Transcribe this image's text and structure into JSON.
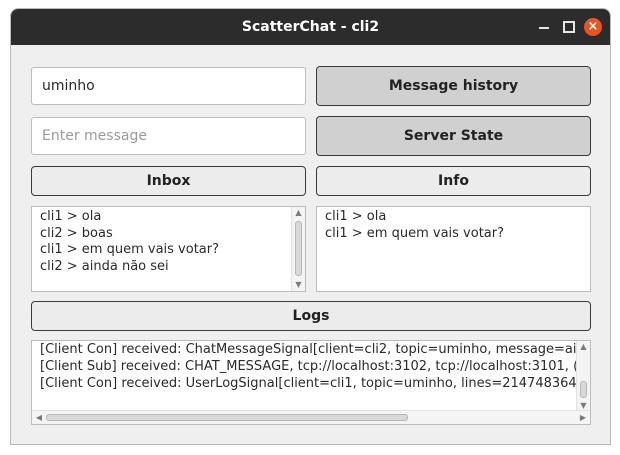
{
  "window": {
    "title": "ScatterChat - cli2",
    "controls": {
      "minimize": "minimize-icon",
      "maximize": "maximize-icon",
      "close": "close-icon",
      "close_glyph": "×"
    }
  },
  "form": {
    "topic_value": "uminho",
    "message_value": "",
    "message_placeholder": "Enter message",
    "history_button": "Message history",
    "server_state_button": "Server State"
  },
  "sections": {
    "inbox_label": "Inbox",
    "info_label": "Info",
    "logs_label": "Logs"
  },
  "inbox": {
    "messages": [
      "cli1 > ola",
      "cli2 > boas",
      "cli1 > em quem vais votar?",
      "cli2 > ainda não sei"
    ]
  },
  "info": {
    "messages": [
      "cli1 > ola",
      "cli1 > em quem vais votar?"
    ]
  },
  "logs": {
    "lines": [
      "[Client Con] received: ChatMessageSignal[client=cli2, topic=uminho, message=ai",
      "[Client Sub] received: CHAT_MESSAGE, tcp://localhost:3102, tcp://localhost:3101, (",
      "[Client Con] received: UserLogSignal[client=cli1, topic=uminho, lines=214748364"
    ]
  },
  "colors": {
    "titlebar": "#2c2c2c",
    "close_button": "#e95420",
    "window_bg": "#efefef",
    "primary_button_bg": "#d0d0d0"
  }
}
